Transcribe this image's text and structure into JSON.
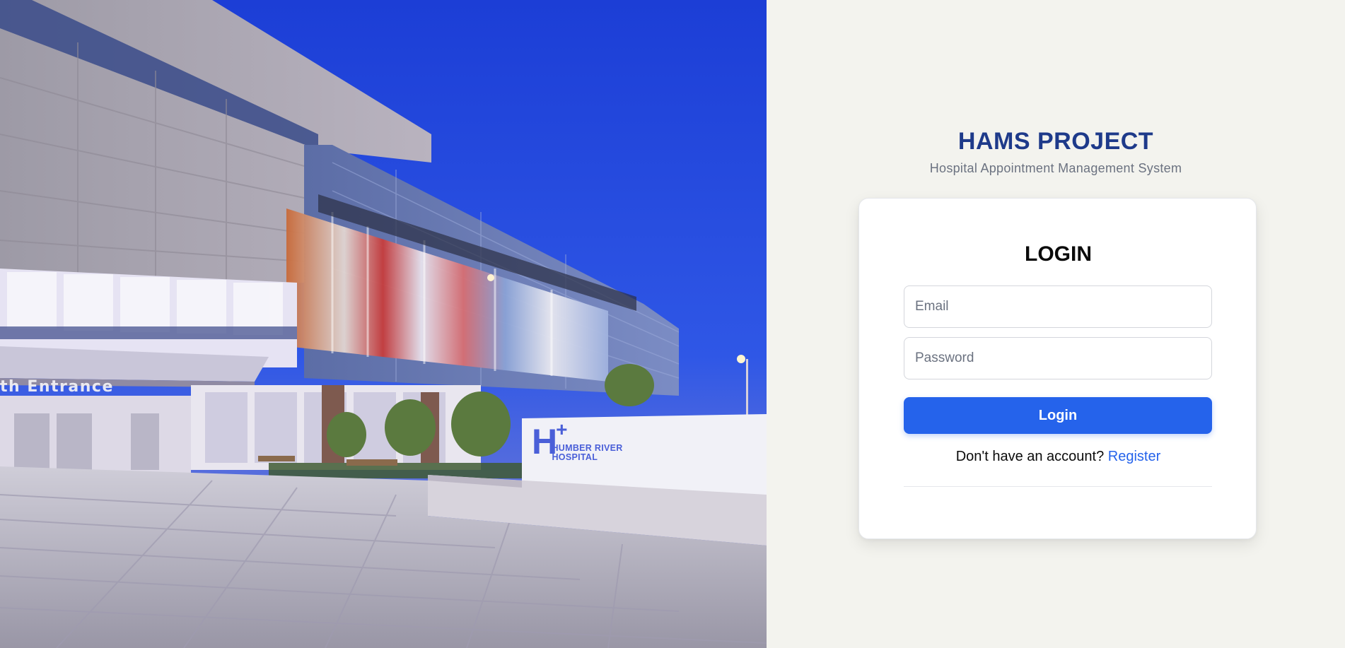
{
  "hero": {
    "entrance_sign": "th Entrance",
    "hospital_sign_line1": "HUMBER RIVER",
    "hospital_sign_line2": "HOSPITAL"
  },
  "brand": {
    "title": "HAMS PROJECT",
    "subtitle": "Hospital Appointment Management System"
  },
  "login": {
    "heading": "LOGIN",
    "email_placeholder": "Email",
    "email_value": "",
    "password_placeholder": "Password",
    "password_value": "",
    "submit_label": "Login",
    "register_prompt": "Don't have an account?",
    "register_link": "Register"
  },
  "colors": {
    "brand_title": "#1e3a8a",
    "primary_button": "#2563eb",
    "link": "#2563eb",
    "panel_background": "#f3f3ee",
    "card_background": "#ffffff"
  }
}
